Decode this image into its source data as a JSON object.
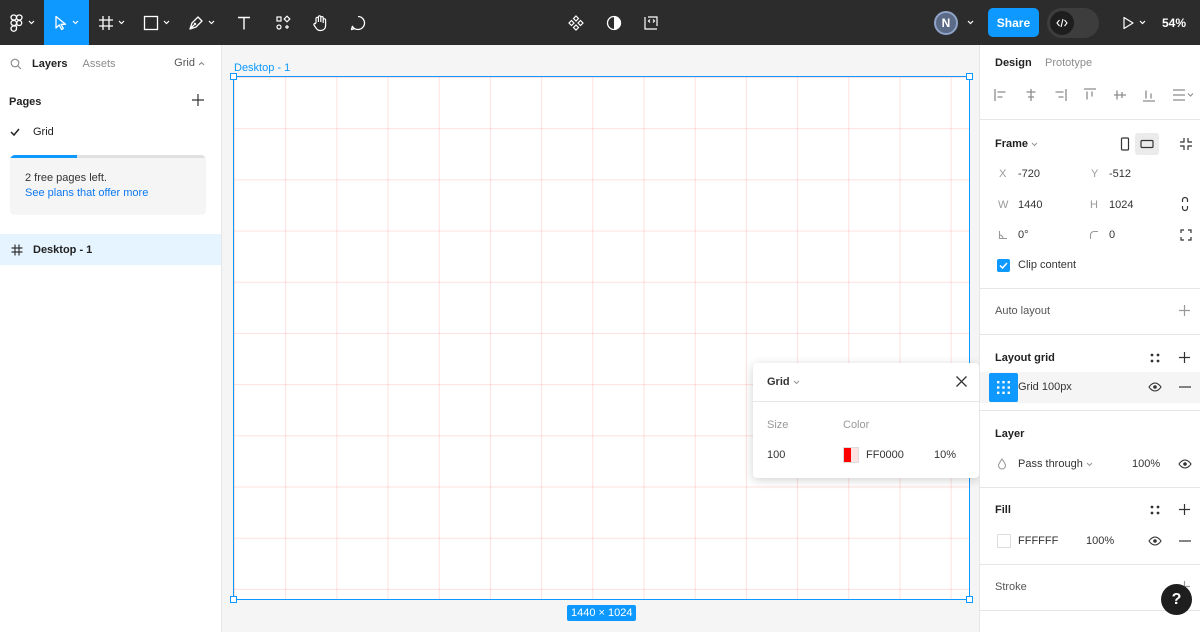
{
  "toolbar": {
    "share_label": "Share",
    "avatar_initial": "N",
    "zoom": "54%"
  },
  "left_panel": {
    "tab_layers": "Layers",
    "tab_assets": "Assets",
    "page_selector": "Grid",
    "pages_header": "Pages",
    "pages": [
      {
        "label": "Grid",
        "selected": true
      }
    ],
    "upgrade_text": "2 free pages left.",
    "upgrade_link": "See plans that offer more",
    "upgrade_progress": 0.34,
    "layers": [
      {
        "label": "Desktop - 1"
      }
    ]
  },
  "canvas": {
    "frame_label": "Desktop - 1",
    "dimensions": "1440 × 1024"
  },
  "grid_popover": {
    "title": "Grid",
    "size_label": "Size",
    "color_label": "Color",
    "size_value": "100",
    "color_hex": "FF0000",
    "opacity": "10%"
  },
  "right_panel": {
    "tab_design": "Design",
    "tab_prototype": "Prototype",
    "frame": {
      "title": "Frame",
      "x_label": "X",
      "x_value": "-720",
      "y_label": "Y",
      "y_value": "-512",
      "w_label": "W",
      "w_value": "1440",
      "h_label": "H",
      "h_value": "1024",
      "rotation": "0°",
      "radius": "0",
      "clip_content": "Clip content"
    },
    "auto_layout": "Auto layout",
    "layout_grid": {
      "title": "Layout grid",
      "item": "Grid 100px"
    },
    "layer": {
      "title": "Layer",
      "blend": "Pass through",
      "opacity": "100%"
    },
    "fill": {
      "title": "Fill",
      "hex": "FFFFFF",
      "opacity": "100%"
    },
    "stroke": "Stroke"
  },
  "help": "?",
  "colors": {
    "accent": "#0d99ff",
    "toolbar_bg": "#2c2c2c",
    "grid_color": "#FF0000"
  }
}
